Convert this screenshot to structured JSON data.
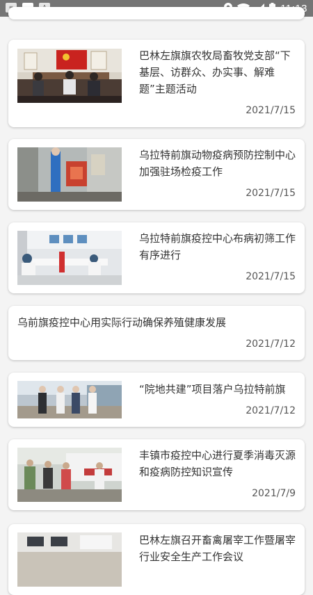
{
  "status_bar": {
    "time": "11:13",
    "left_chips": [
      "≡",
      "",
      "A"
    ]
  },
  "articles": [
    {
      "title": "巴林左旗旗农牧局畜牧党支部“下基层、访群众、办实事、解难题”主题活动",
      "date": "2021/7/15",
      "thumb": "meeting-room-photo"
    },
    {
      "title": "乌拉特前旗动物疫病预防控制中心加强驻场检疫工作",
      "date": "2021/7/15",
      "thumb": "quarantine-inspection-photo"
    },
    {
      "title": "乌拉特前旗疫控中心布病初筛工作有序进行",
      "date": "2021/7/15",
      "thumb": "lab-screening-photo"
    },
    {
      "title": "乌前旗疫控中心用实际行动确保养殖健康发展",
      "date": "2021/7/12"
    },
    {
      "title": "“院地共建”项目落户乌拉特前旗",
      "date": "2021/7/12",
      "thumb": "outdoor-visit-photo"
    },
    {
      "title": "丰镇市疫控中心进行夏季消毒灭源和疫病防控知识宣传",
      "date": "2021/7/9",
      "thumb": "street-campaign-photo"
    },
    {
      "title": "巴林左旗召开畜禽屠宰工作暨屠宰行业安全生产工作会议",
      "date": "",
      "thumb": "conference-photo"
    }
  ]
}
